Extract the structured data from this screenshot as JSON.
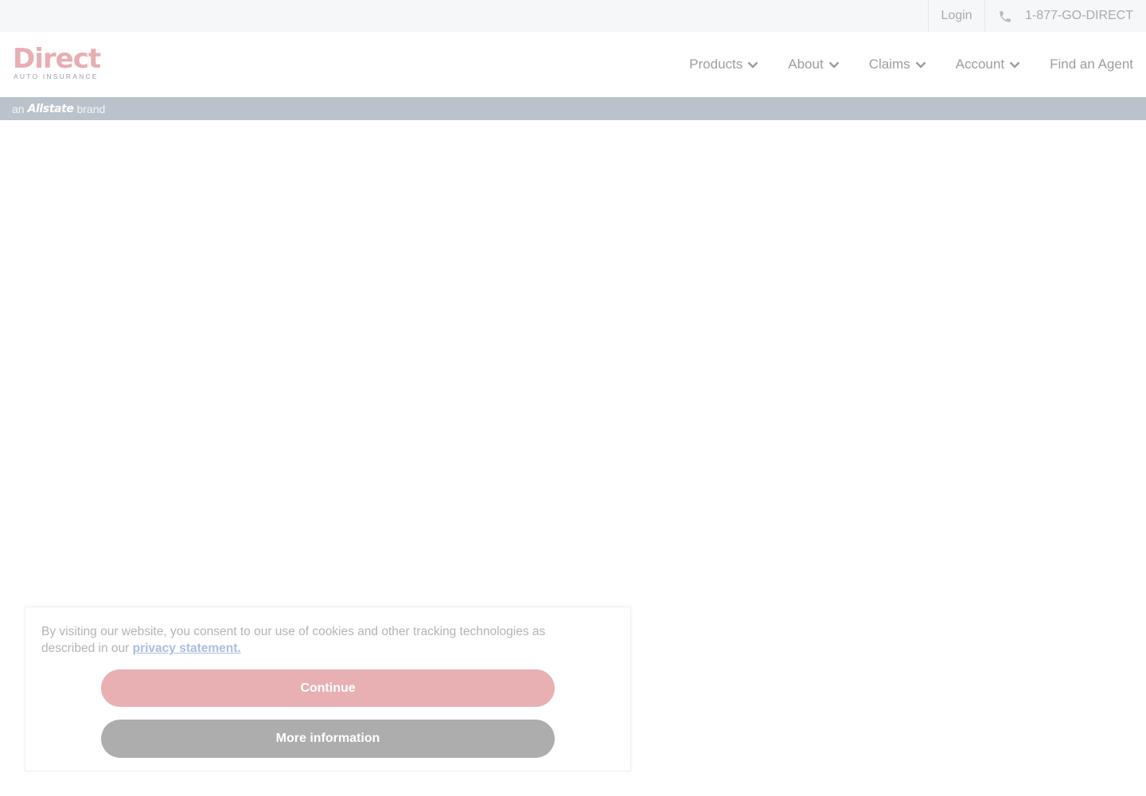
{
  "utility_bar": {
    "login_label": "Login",
    "phone_label": "1-877-GO-DIRECT",
    "phone_icon": "phone-icon"
  },
  "header": {
    "logo": {
      "wordmark": "Direct",
      "subline": "AUTO INSURANCE",
      "color": "#e8aeb2"
    },
    "nav": [
      {
        "label": "Products",
        "has_dropdown": true
      },
      {
        "label": "About",
        "has_dropdown": true
      },
      {
        "label": "Claims",
        "has_dropdown": true
      },
      {
        "label": "Account",
        "has_dropdown": true
      },
      {
        "label": "Find an Agent",
        "has_dropdown": false
      }
    ]
  },
  "brand_strip": {
    "prefix": "an",
    "brand": "Allstate",
    "suffix": "brand"
  },
  "cookie_banner": {
    "text": "By visiting our website, you consent to our use of cookies and other tracking technologies as described in our",
    "link_label": "privacy statement.",
    "continue_label": "Continue",
    "more_info_label": "More information"
  },
  "colors": {
    "brand_pink": "#e8b0b3",
    "strip_gray_blue": "#bac3cc",
    "button_gray": "#adadad",
    "link_blue": "#a9bde0"
  }
}
